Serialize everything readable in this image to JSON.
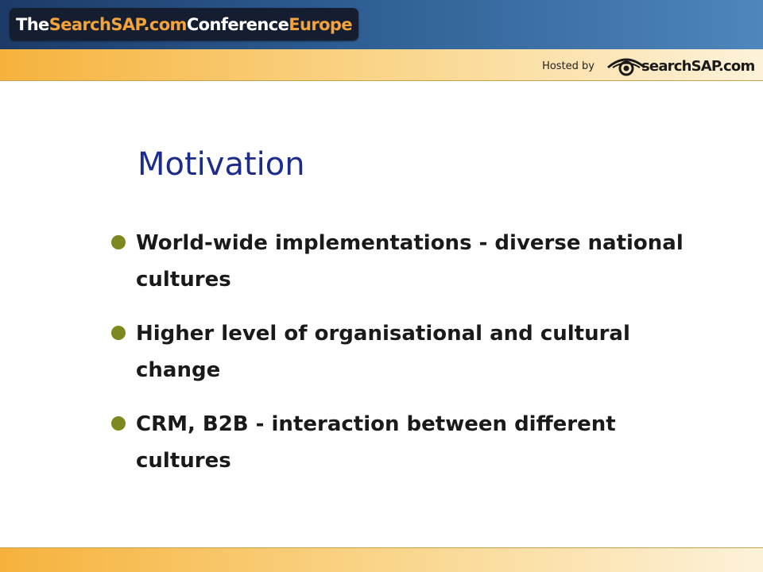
{
  "header": {
    "title_part1": "The ",
    "title_accent1": "SearchSAP.com",
    "title_part2": " Conference ",
    "title_accent2": "Europe",
    "hosted_by": "Hosted by",
    "logo_text": "searchSAP.com",
    "logo_icon": "eye-icon"
  },
  "slide": {
    "title": "Motivation",
    "bullets": [
      {
        "text": "World-wide implementations - diverse national cultures"
      },
      {
        "text": "Higher level of organisational and cultural change"
      },
      {
        "text": "CRM, B2B - interaction between different cultures"
      }
    ]
  },
  "colors": {
    "title": "#1c2c8c",
    "bullet": "#7d891e",
    "accent": "#f4a23a",
    "header_blue": "#2d5d93",
    "band_gold": "#f6b23c"
  }
}
